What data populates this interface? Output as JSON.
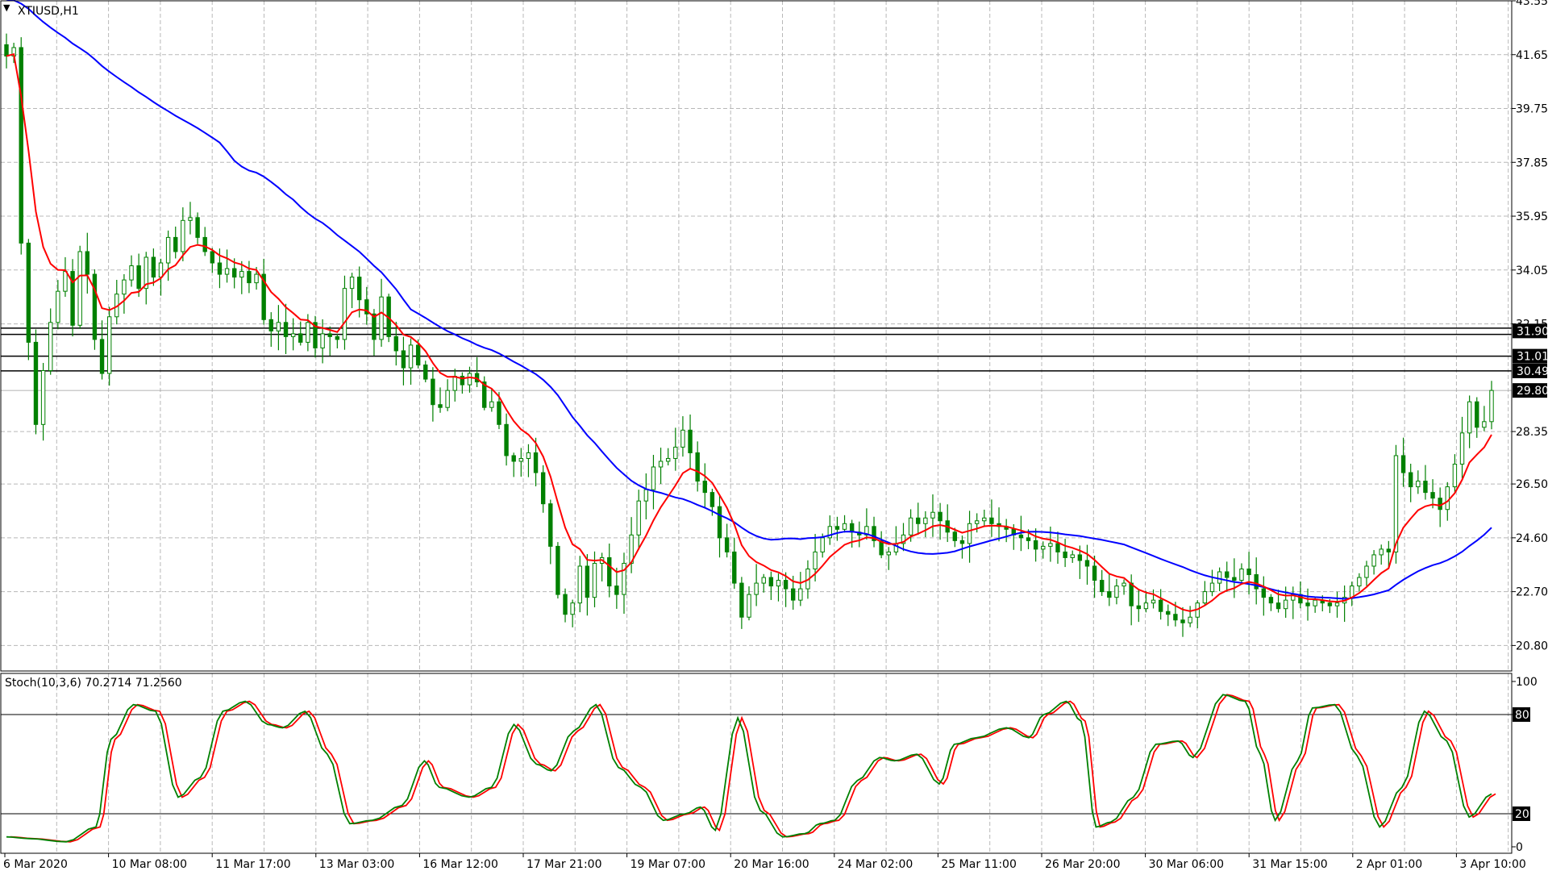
{
  "window": {
    "symbol_label": "XTIUSD,H1"
  },
  "indicator": {
    "label": "Stoch(10,3,6) 70.2714 71.2560"
  },
  "colors": {
    "background": "#ffffff",
    "grid": "#b8b8b8",
    "candle": "#008000",
    "ma_fast": "#ff0000",
    "ma_slow": "#0000ff",
    "stoch_main": "#008000",
    "stoch_signal": "#ff0000",
    "hline": "#000000"
  },
  "chart_data": [
    {
      "type": "candlestick",
      "title": "XTIUSD,H1",
      "ylim": [
        19.9,
        43.55
      ],
      "y_ticks": [
        "43.55",
        "41.65",
        "39.75",
        "37.85",
        "35.95",
        "34.05",
        "32.15",
        "28.35",
        "26.50",
        "24.60",
        "22.70",
        "20.80"
      ],
      "x_ticks": [
        "6 Mar 2020",
        "10 Mar 08:00",
        "11 Mar 17:00",
        "13 Mar 03:00",
        "16 Mar 12:00",
        "17 Mar 21:00",
        "19 Mar 07:00",
        "20 Mar 16:00",
        "24 Mar 02:00",
        "25 Mar 11:00",
        "26 Mar 20:00",
        "30 Mar 06:00",
        "31 Mar 15:00",
        "2 Apr 01:00",
        "3 Apr 10:00"
      ],
      "price_markers": [
        {
          "label": "31.90",
          "value": 31.9
        },
        {
          "label": "31.01",
          "value": 31.01
        },
        {
          "label": "30.49",
          "value": 30.49
        },
        {
          "label": "29.80",
          "value": 29.8
        }
      ],
      "horizontal_lines": [
        32.0,
        31.78,
        31.01,
        30.49
      ],
      "close_series": [
        41.6,
        41.9,
        35.0,
        31.5,
        28.6,
        30.5,
        32.2,
        33.3,
        34.0,
        32.1,
        34.7,
        33.9,
        31.6,
        30.4,
        32.4,
        33.2,
        33.7,
        34.2,
        33.4,
        34.5,
        33.8,
        34.3,
        35.2,
        34.7,
        35.8,
        35.9,
        35.2,
        34.7,
        34.3,
        33.9,
        34.1,
        33.8,
        34.0,
        33.6,
        33.9,
        32.3,
        31.9,
        32.2,
        31.7,
        31.8,
        31.5,
        32.2,
        31.3,
        31.8,
        31.7,
        31.6,
        33.4,
        33.8,
        33.0,
        32.5,
        31.6,
        33.1,
        31.7,
        31.2,
        30.6,
        31.4,
        30.7,
        30.2,
        29.3,
        29.2,
        29.8,
        30.3,
        30.0,
        30.4,
        30.1,
        29.2,
        29.4,
        28.6,
        27.5,
        27.3,
        27.4,
        27.6,
        26.9,
        25.8,
        24.3,
        22.6,
        21.9,
        22.3,
        23.6,
        22.5,
        23.7,
        23.9,
        22.9,
        22.6,
        23.7,
        24.7,
        25.9,
        26.3,
        27.1,
        27.3,
        27.4,
        27.8,
        28.4,
        27.6,
        26.6,
        26.2,
        25.7,
        24.6,
        24.1,
        23.0,
        21.8,
        22.6,
        23.0,
        23.2,
        22.9,
        23.1,
        22.8,
        22.4,
        22.8,
        23.5,
        24.1,
        24.6,
        25.0,
        24.9,
        25.1,
        24.8,
        24.7,
        25.0,
        24.5,
        24.0,
        24.1,
        24.4,
        24.7,
        25.3,
        25.1,
        25.3,
        25.5,
        25.2,
        24.8,
        24.5,
        24.4,
        25.1,
        25.2,
        25.3,
        25.1,
        25.0,
        24.9,
        24.7,
        24.6,
        24.5,
        24.2,
        24.3,
        24.4,
        24.1,
        23.9,
        24.0,
        23.8,
        23.6,
        23.1,
        22.7,
        22.5,
        22.9,
        23.0,
        22.2,
        22.1,
        22.3,
        22.4,
        22.0,
        21.9,
        21.7,
        21.6,
        21.8,
        22.3,
        22.7,
        23.0,
        23.4,
        23.2,
        23.1,
        23.5,
        23.3,
        22.8,
        22.5,
        22.3,
        22.1,
        22.4,
        22.6,
        22.3,
        22.2,
        22.4,
        22.3,
        22.2,
        22.3,
        22.5,
        22.9,
        23.2,
        23.6,
        24.0,
        24.2,
        24.1,
        27.5,
        26.9,
        26.4,
        26.6,
        26.2,
        26.0,
        25.6,
        26.4,
        27.2,
        28.3,
        29.4,
        28.5,
        28.7,
        29.8
      ]
    },
    {
      "type": "line",
      "title": "Stoch(10,3,6)",
      "ylim": [
        0,
        100
      ],
      "y_ticks": [
        "100",
        "80",
        "20",
        "0"
      ],
      "levels": [
        80,
        20
      ],
      "series": [
        {
          "name": "main",
          "value": 70.2714
        },
        {
          "name": "signal",
          "value": 71.256
        }
      ],
      "keypoints": [
        [
          0,
          6
        ],
        [
          3,
          5
        ],
        [
          8,
          3
        ],
        [
          12,
          12
        ],
        [
          14,
          65
        ],
        [
          17,
          86
        ],
        [
          20,
          82
        ],
        [
          23,
          30
        ],
        [
          26,
          42
        ],
        [
          29,
          82
        ],
        [
          32,
          88
        ],
        [
          35,
          74
        ],
        [
          37,
          72
        ],
        [
          40,
          82
        ],
        [
          43,
          56
        ],
        [
          46,
          14
        ],
        [
          49,
          16
        ],
        [
          53,
          25
        ],
        [
          56,
          52
        ],
        [
          58,
          36
        ],
        [
          62,
          30
        ],
        [
          65,
          36
        ],
        [
          68,
          74
        ],
        [
          71,
          50
        ],
        [
          73,
          46
        ],
        [
          76,
          70
        ],
        [
          79,
          86
        ],
        [
          82,
          48
        ],
        [
          85,
          36
        ],
        [
          88,
          16
        ],
        [
          91,
          20
        ],
        [
          93,
          24
        ],
        [
          95,
          10
        ],
        [
          98,
          78
        ],
        [
          101,
          22
        ],
        [
          104,
          6
        ],
        [
          107,
          8
        ],
        [
          109,
          14
        ],
        [
          111,
          16
        ],
        [
          114,
          40
        ],
        [
          117,
          54
        ],
        [
          119,
          52
        ],
        [
          122,
          56
        ],
        [
          125,
          38
        ],
        [
          127,
          62
        ],
        [
          130,
          66
        ],
        [
          134,
          72
        ],
        [
          137,
          66
        ],
        [
          139,
          80
        ],
        [
          142,
          88
        ],
        [
          144,
          76
        ],
        [
          146,
          12
        ],
        [
          148,
          15
        ],
        [
          151,
          30
        ],
        [
          154,
          62
        ],
        [
          157,
          64
        ],
        [
          159,
          54
        ],
        [
          163,
          92
        ],
        [
          166,
          88
        ],
        [
          168,
          56
        ],
        [
          170,
          16
        ],
        [
          173,
          52
        ],
        [
          175,
          84
        ],
        [
          178,
          86
        ],
        [
          181,
          55
        ],
        [
          184,
          12
        ],
        [
          187,
          36
        ],
        [
          190,
          82
        ],
        [
          193,
          64
        ],
        [
          196,
          18
        ],
        [
          199,
          32
        ]
      ]
    }
  ]
}
